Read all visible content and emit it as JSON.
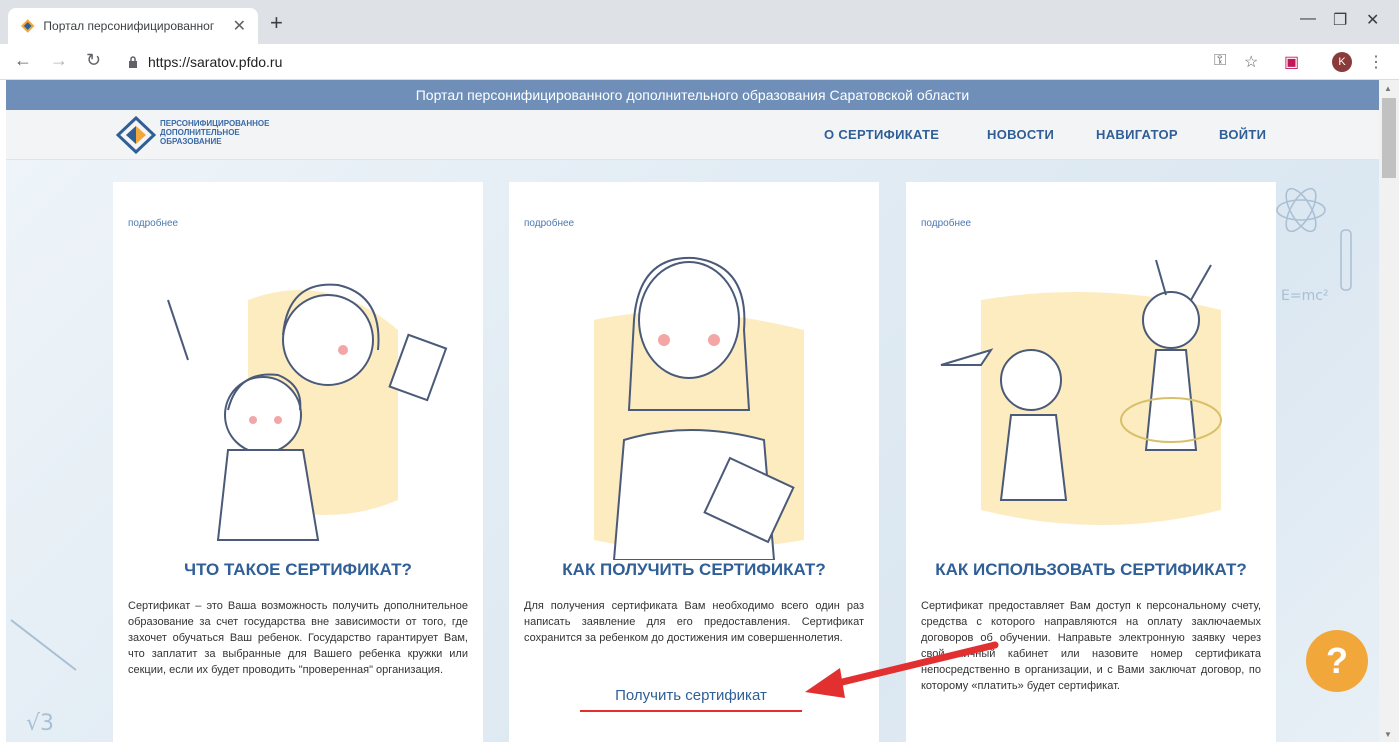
{
  "browser": {
    "tab_title": "Портал персонифицированног",
    "url": "https://saratov.pfdo.ru",
    "avatar_letter": "K"
  },
  "site": {
    "banner": "Портал персонифицированного дополнительного образования Саратовской области",
    "logo_lines": [
      "ПЕРСОНИФИЦИРОВАННОЕ",
      "ДОПОЛНИТЕЛЬНОЕ",
      "ОБРАЗОВАНИЕ"
    ],
    "nav": [
      "О СЕРТИФИКАТЕ",
      "НОВОСТИ",
      "НАВИГАТОР",
      "ВОЙТИ"
    ]
  },
  "cards": [
    {
      "more": "подробнее",
      "title": "ЧТО ТАКОЕ СЕРТИФИКАТ?",
      "text": "Сертификат – это Ваша возможность получить дополнительное образование за счет государства вне зависимости от того, где захочет обучаться Ваш ребенок. Государство гарантирует Вам, что заплатит за выбранные для Вашего ребенка кружки или секции, если их будет проводить \"проверенная\" организация."
    },
    {
      "more": "подробнее",
      "title": "КАК ПОЛУЧИТЬ СЕРТИФИКАТ?",
      "text": "Для получения сертификата Вам необходимо всего один раз написать заявление для его предоставления. Сертификат сохранится за ребенком до достижения им совершеннолетия."
    },
    {
      "more": "подробнее",
      "title": "КАК ИСПОЛЬЗОВАТЬ СЕРТИФИКАТ?",
      "text": "Сертификат предоставляет Вам доступ к персональному счету, средства с которого направляются на оплату заключаемых договоров об обучении. Направьте электронную заявку через свой личный кабинет или назовите номер сертификата непосредственно в организации, и с Вами заключат договор, по которому «платить» будет сертификат."
    }
  ],
  "get_cert_label": "Получить сертификат",
  "help_label": "?",
  "colors": {
    "accent": "#2f5f96",
    "banner": "#6f8fb8",
    "arrow": "#e23030",
    "help": "#f2a73b"
  }
}
